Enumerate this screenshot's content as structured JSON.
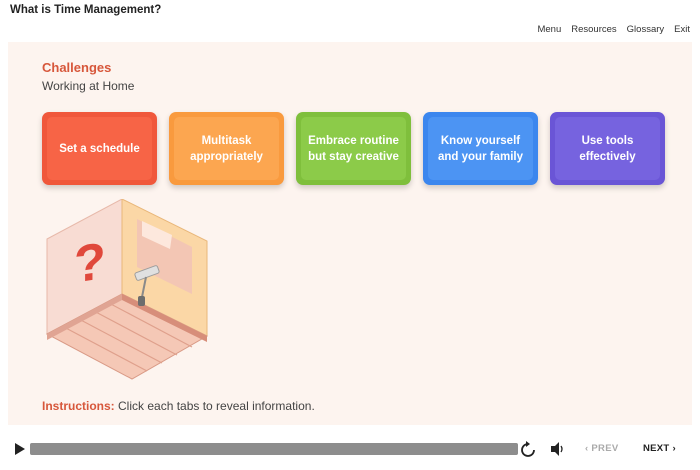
{
  "app": {
    "title": "What is Time Management?"
  },
  "nav": {
    "items": [
      "Menu",
      "Resources",
      "Glossary",
      "Exit"
    ]
  },
  "slide": {
    "heading": "Challenges",
    "subheading": "Working at Home",
    "tabs": [
      {
        "label": "Set a schedule",
        "color": "#f76446"
      },
      {
        "label": "Multitask appropriately",
        "color": "#fca650"
      },
      {
        "label": "Embrace routine but stay creative",
        "color": "#8ccb49"
      },
      {
        "label": "Know yourself and your family",
        "color": "#4c94f3"
      },
      {
        "label": "Use tools effectively",
        "color": "#7663df"
      }
    ],
    "illustration_icon": "question-mark-room-illustration",
    "instructions": {
      "label": "Instructions:",
      "text": "Click each tabs to reveal information."
    }
  },
  "player": {
    "progress": 1.0,
    "prev_label": "PREV",
    "next_label": "NEXT",
    "icons": {
      "play": "play-icon",
      "replay": "replay-icon",
      "volume": "volume-icon"
    }
  },
  "colors": {
    "accent": "#d7573b",
    "slide_bg": "#fdf4ef"
  }
}
